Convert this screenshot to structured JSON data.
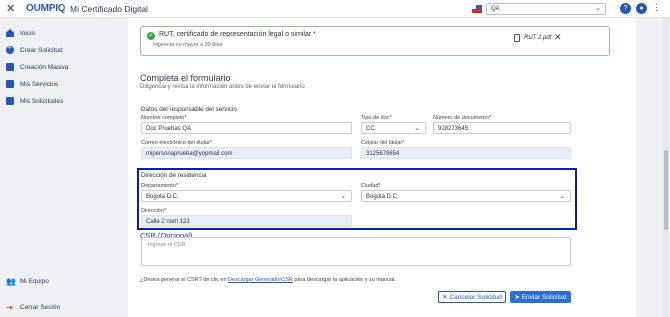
{
  "header": {
    "brand": "OUMPIQ",
    "separator": "|",
    "app_title": "Mi Certificado Digital",
    "env_value": "QA",
    "help_icon": "?",
    "user_icon": "👤"
  },
  "sidebar": {
    "items": [
      {
        "label": "Inicio",
        "icon": "home-icon"
      },
      {
        "label": "Crear Solicitud",
        "icon": "plus-circle-icon"
      },
      {
        "label": "Creación Masiva",
        "icon": "bulk-icon"
      },
      {
        "label": "Mis Servicios",
        "icon": "folder-icon"
      },
      {
        "label": "Mis Solicitudes",
        "icon": "folder-icon"
      }
    ],
    "team": "Mi Equipo",
    "logout": "Cerrar Sesión"
  },
  "document": {
    "title": "RUT, certificado de representación legal o similar *",
    "subtitle": "Vigencia no mayor a 30 días",
    "file": "RUT 2.pdf"
  },
  "form": {
    "title": "Completa el formulario",
    "subtitle": "Diligencia y revisa la información antes de enviar el formulario",
    "responsible_heading": "Datos del responsable del servicio",
    "fields": {
      "full_name_label": "Nombre completo*",
      "full_name_value": "Doc Pruebas QA",
      "doc_type_label": "Tipo de doc*",
      "doc_type_value": "CC",
      "doc_number_label": "Número de documento*",
      "doc_number_value": "918273645",
      "email_label": "Correo electrónico del titular*",
      "email_value": "mipersonaprueba@yopmail.com",
      "phone_label": "Celular del titular*",
      "phone_value": "3125678654"
    },
    "residence": {
      "heading": "Dirección de residencia",
      "department_label": "Departamento*",
      "department_value": "Bogotá D.C.",
      "city_label": "Ciudad*",
      "city_value": "Bogotá D.C.",
      "address_label": "Dirección*",
      "address_value": "Calle 2 num 123"
    },
    "csr": {
      "title": "CSR (Opcional)",
      "placeholder": "Ingrese el CSR"
    },
    "footer_prefix": "¿Desea generar el CSR? de clic en ",
    "footer_link": "Descargar GeneradorCSR",
    "footer_suffix": " para descargar la aplicación y su manual.",
    "cancel_label": "✕ Cancelar Solicitud",
    "send_label": "➤ Enviar Solicitud"
  },
  "colors": {
    "brand": "#2457b8",
    "highlight": "#0b1ea8",
    "success": "#3aa54a",
    "danger": "#d62b2b"
  }
}
